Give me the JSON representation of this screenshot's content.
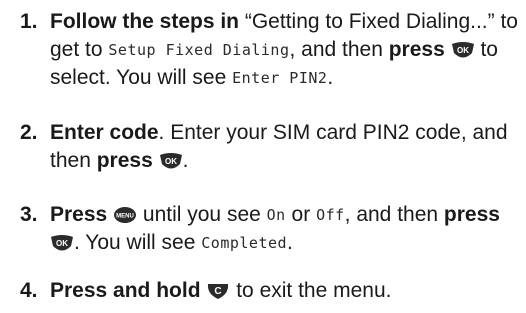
{
  "steps": [
    {
      "number": "1.",
      "lead": "Follow the steps in",
      "text_a": " “Getting to Fixed Dialing...” to get to ",
      "lcd_a": "Setup Fixed Dialing",
      "text_b": ", and then ",
      "press": "press",
      "key": "OK",
      "text_c": " to select. You will see ",
      "lcd_b": "Enter PIN2",
      "text_d": "."
    },
    {
      "number": "2.",
      "lead": "Enter code",
      "text_a": ". Enter your SIM card PIN2 code, and then ",
      "press": "press",
      "key": "OK",
      "text_b": "."
    },
    {
      "number": "3.",
      "lead": "Press",
      "key_a": "MENU",
      "text_a": " until you see ",
      "lcd_a": "On",
      "text_or": " or ",
      "lcd_b": "Off",
      "text_b": ", and then ",
      "press": "press",
      "key_b": "OK",
      "text_c": ". You will see ",
      "lcd_c": "Completed",
      "text_d": "."
    },
    {
      "number": "4.",
      "lead": "Press and hold",
      "key": "C",
      "text_a": " to exit the menu."
    }
  ],
  "colors": {
    "text": "#1a1a1a",
    "key": "#2b2b2b"
  }
}
